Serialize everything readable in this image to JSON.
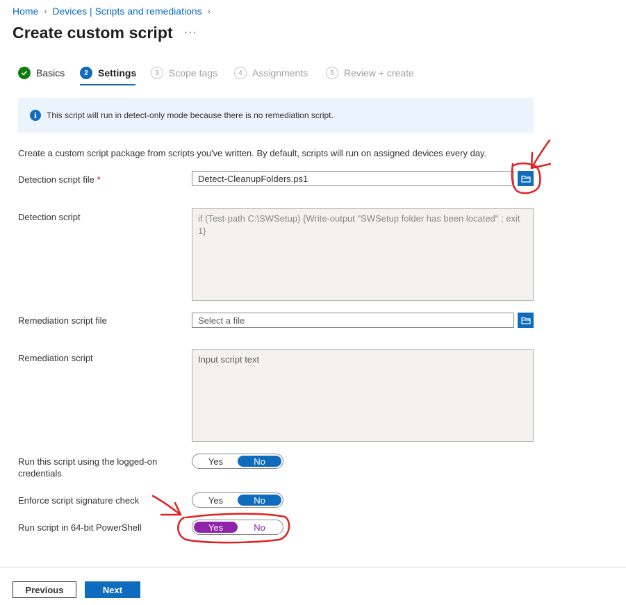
{
  "breadcrumb": [
    "Home",
    "Devices | Scripts and remediations"
  ],
  "page_title": "Create custom script",
  "more_label": "···",
  "steps": [
    {
      "num": "✓",
      "label": "Basics",
      "state": "done"
    },
    {
      "num": "2",
      "label": "Settings",
      "state": "active"
    },
    {
      "num": "3",
      "label": "Scope tags",
      "state": "todo"
    },
    {
      "num": "4",
      "label": "Assignments",
      "state": "todo"
    },
    {
      "num": "5",
      "label": "Review + create",
      "state": "todo"
    }
  ],
  "banner": {
    "icon": "info-icon",
    "text": "This script will run in detect-only mode because there is no remediation script."
  },
  "description": "Create a custom script package from scripts you've written. By default, scripts will run on assigned devices every day.",
  "detection_file": {
    "label": "Detection script file",
    "required_mark": "*",
    "value": "Detect-CleanupFolders.ps1"
  },
  "detection_script": {
    "label": "Detection script",
    "value": "if (Test-path C:\\SWSetup) {Write-output \"SWSetup folder has been located\" ; exit 1}"
  },
  "remediation_file": {
    "label": "Remediation script file",
    "placeholder": "Select a file"
  },
  "remediation_script": {
    "label": "Remediation script",
    "placeholder": "Input script text"
  },
  "toggles": [
    {
      "label": "Run this script using the logged-on credentials",
      "yes": "Yes",
      "no": "No",
      "selected": "No"
    },
    {
      "label": "Enforce script signature check",
      "yes": "Yes",
      "no": "No",
      "selected": "No"
    },
    {
      "label": "Run script in 64-bit PowerShell",
      "yes": "Yes",
      "no": "No",
      "selected": "Yes"
    }
  ],
  "footer": {
    "previous": "Previous",
    "next": "Next"
  },
  "colors": {
    "accent": "#0f6cbd",
    "annotation": "#e02020",
    "highlight": "#8e24aa"
  }
}
